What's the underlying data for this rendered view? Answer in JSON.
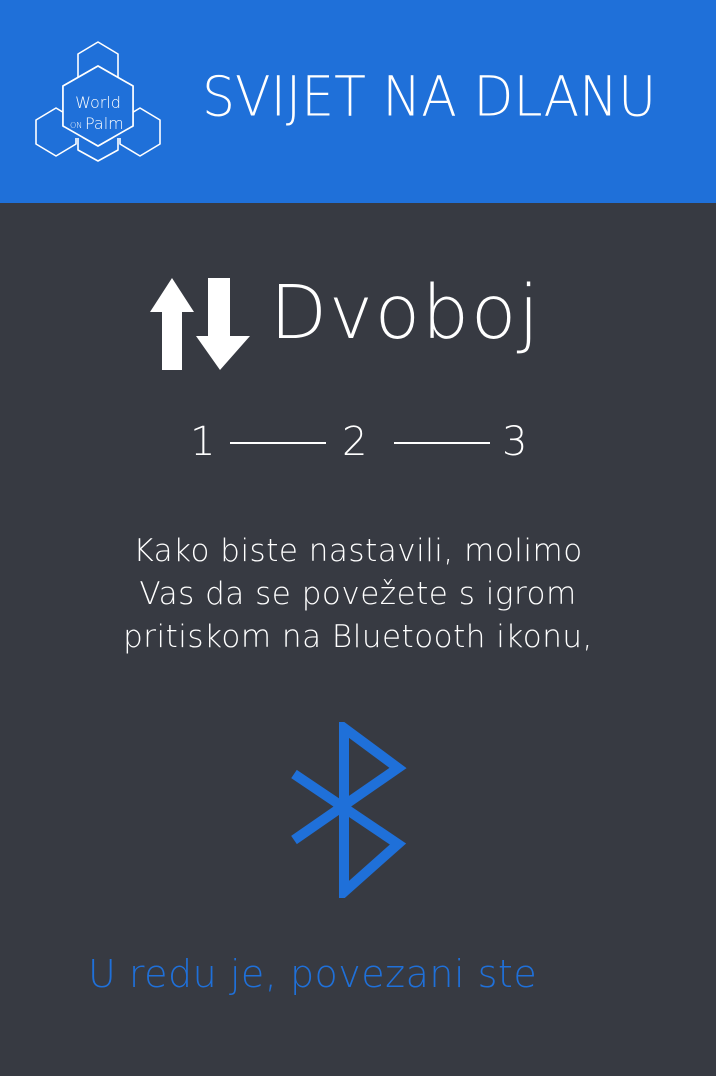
{
  "header": {
    "title": "SVIJET NA DLANU",
    "logo": {
      "icon": "hexagon-logo-icon",
      "line1": "World",
      "line2_small": "ON",
      "line2": "Palm"
    }
  },
  "mode": {
    "icon": "up-down-arrows-icon",
    "title": "Dvoboj"
  },
  "steps": [
    "1",
    "2",
    "3"
  ],
  "message": {
    "lines": [
      "Kako biste nastavili, molimo",
      "Vas da se povežete s igrom",
      "pritiskom na Bluetooth ikonu,"
    ]
  },
  "bluetooth": {
    "icon": "bluetooth-icon"
  },
  "status": {
    "text": "U redu je, povezani ste"
  },
  "colors": {
    "header_bg": "#1f70d9",
    "page_bg": "#373a42",
    "accent": "#1f70d9",
    "text": "#ffffff"
  }
}
